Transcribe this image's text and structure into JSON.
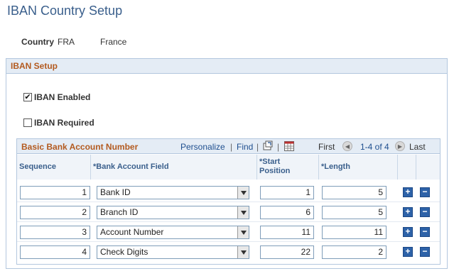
{
  "page": {
    "title": "IBAN Country Setup"
  },
  "country": {
    "label": "Country",
    "code": "FRA",
    "name": "France"
  },
  "iban_setup": {
    "header": "IBAN Setup",
    "iban_enabled": {
      "label": "IBAN Enabled",
      "checked": true,
      "mark": "✔"
    },
    "iban_required": {
      "label": "IBAN Required",
      "checked": false,
      "mark": ""
    }
  },
  "grid": {
    "title": "Basic Bank Account Number",
    "personalize": "Personalize",
    "sep": "|",
    "find": "Find",
    "first": "First",
    "range": "1-4 of 4",
    "last": "Last",
    "columns": {
      "sequence": "Sequence",
      "bank_field": "*Bank Account Field",
      "start_pos_1": "*Start",
      "start_pos_2": "Position",
      "length": "*Length"
    },
    "rows": [
      {
        "sequence": "1",
        "field": "Bank ID",
        "start": "1",
        "length": "5"
      },
      {
        "sequence": "2",
        "field": "Branch ID",
        "start": "6",
        "length": "5"
      },
      {
        "sequence": "3",
        "field": "Account Number",
        "start": "11",
        "length": "11"
      },
      {
        "sequence": "4",
        "field": "Check Digits",
        "start": "22",
        "length": "2"
      }
    ],
    "add_symbol": "+",
    "delete_symbol": "−"
  },
  "colors": {
    "title": "#3a5f8c",
    "section_header": "#b35a1f",
    "link": "#1f4f8f",
    "button": "#2d62a8"
  }
}
